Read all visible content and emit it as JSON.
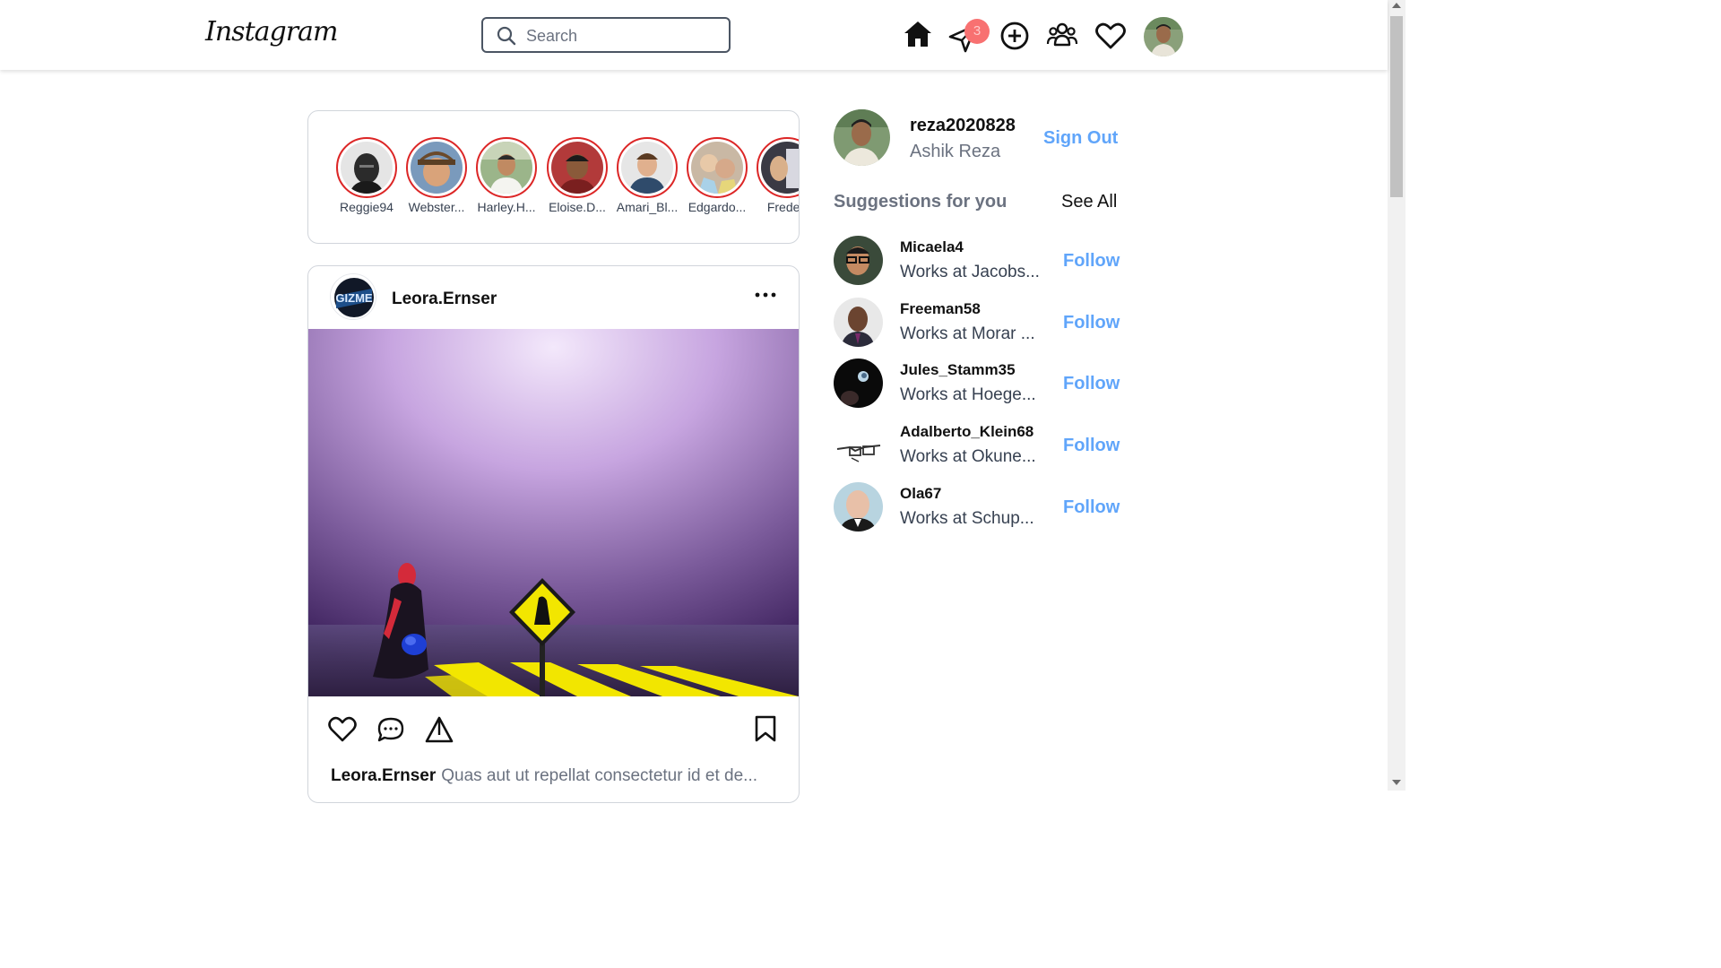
{
  "header": {
    "logo": "Instagram",
    "search_placeholder": "Search",
    "messages_badge": "3",
    "icons": [
      "home-icon",
      "send-icon",
      "add-post-icon",
      "people-icon",
      "heart-icon"
    ]
  },
  "stories": [
    {
      "name": "Reggie94"
    },
    {
      "name": "Webster..."
    },
    {
      "name": "Harley.H..."
    },
    {
      "name": "Eloise.D..."
    },
    {
      "name": "Amari_Bl..."
    },
    {
      "name": "Edgardo..."
    },
    {
      "name": "Frederi"
    }
  ],
  "post": {
    "username": "Leora.Ernser",
    "caption_user": "Leora.Ernser",
    "caption_text": "Quas aut ut repellat consectetur id et de..."
  },
  "sidebar": {
    "username": "reza2020828",
    "full_name": "Ashik Reza",
    "sign_out": "Sign Out",
    "suggestions_title": "Suggestions for you",
    "see_all": "See All",
    "follow_label": "Follow",
    "suggestions": [
      {
        "username": "Micaela4",
        "subtitle": "Works at Jacobs..."
      },
      {
        "username": "Freeman58",
        "subtitle": "Works at Morar ..."
      },
      {
        "username": "Jules_Stamm35",
        "subtitle": "Works at Hoege..."
      },
      {
        "username": "Adalberto_Klein68",
        "subtitle": "Works at Okune..."
      },
      {
        "username": "Ola67",
        "subtitle": "Works at Schup..."
      }
    ]
  },
  "colors": {
    "accent": "#60a5fa",
    "story_ring": "#dc2626",
    "badge": "#f87171"
  }
}
